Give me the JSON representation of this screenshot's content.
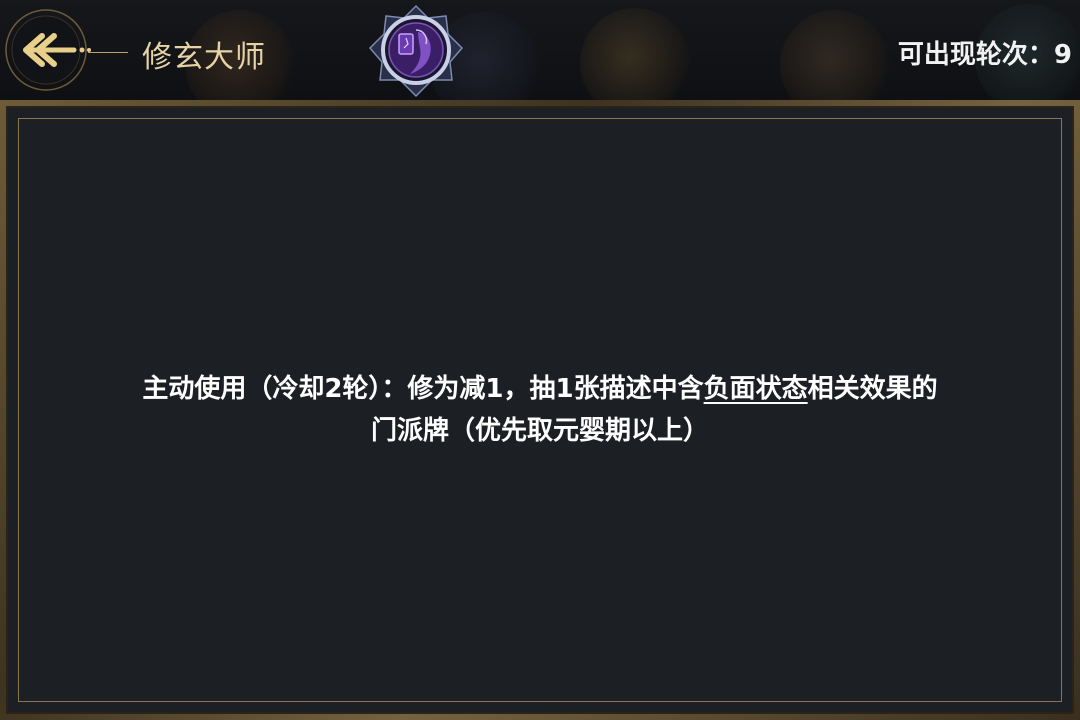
{
  "header": {
    "title": "修玄大师",
    "rounds_label": "可出现轮次：",
    "rounds_value": "9"
  },
  "description": {
    "line1_part1": "主动使用（冷却2轮）：修为减1，抽1张描述中含",
    "line1_keyword": "负面状态",
    "line1_part2": "相关效果的",
    "line2": "门派牌（优先取元婴期以上）"
  },
  "colors": {
    "gold": "#e6d3a6",
    "text": "#ffffff",
    "panel": "#1c2025",
    "emblem_glow": "#7a3cc8"
  },
  "icons": {
    "back": "back-arrow-icon",
    "emblem": "sect-emblem-icon"
  }
}
